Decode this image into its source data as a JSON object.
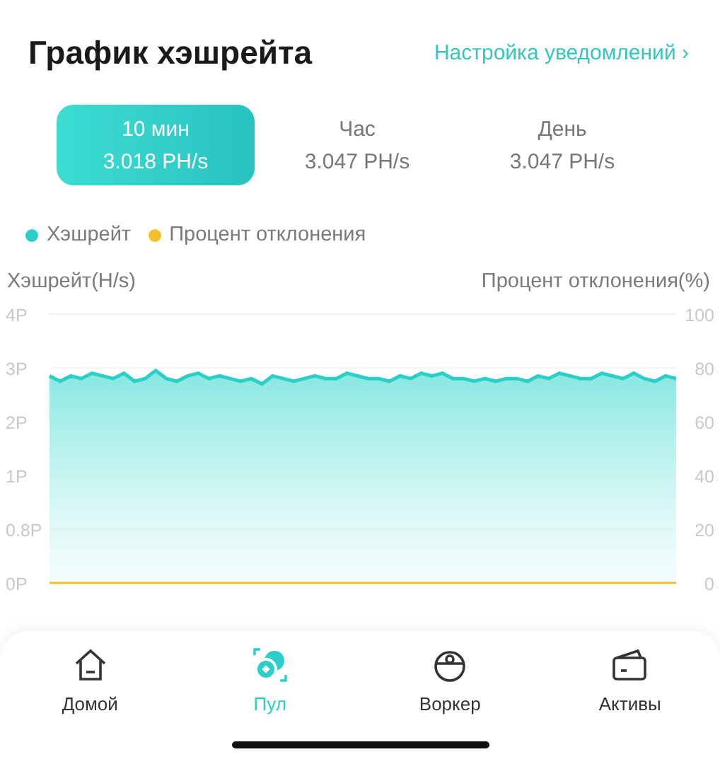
{
  "header": {
    "title": "График хэшрейта",
    "link": "Настройка уведомлений",
    "link_chevron": "›"
  },
  "periods": [
    {
      "label": "10 мин",
      "value": "3.018 PH/s",
      "selected": true
    },
    {
      "label": "Час",
      "value": "3.047 PH/s",
      "selected": false
    },
    {
      "label": "День",
      "value": "3.047 PH/s",
      "selected": false
    }
  ],
  "left_axis_labels": [
    "4P",
    "3P",
    "2P",
    "1P",
    "0.8P",
    "0P"
  ],
  "axis_titles": {
    "left": "Хэшрейт(H/s)",
    "right": "Процент отклонения(%)"
  },
  "chart_data": {
    "type": "line",
    "ylim": [
      0,
      100
    ],
    "yticks": [
      0,
      20,
      40,
      60,
      80,
      100
    ],
    "series": [
      {
        "name": "Хэшрейт",
        "color": "#2ccfc8",
        "values": [
          77,
          75,
          77,
          76,
          78,
          77,
          76,
          78,
          75,
          76,
          79,
          76,
          75,
          77,
          78,
          76,
          77,
          76,
          75,
          76,
          74,
          77,
          76,
          75,
          76,
          77,
          76,
          76,
          78,
          77,
          76,
          76,
          75,
          77,
          76,
          78,
          77,
          78,
          76,
          76,
          75,
          76,
          75,
          76,
          76,
          75,
          77,
          76,
          78,
          77,
          76,
          76,
          78,
          77,
          76,
          78,
          76,
          75,
          77,
          76
        ]
      },
      {
        "name": "Процент отклонения",
        "color": "#f5bf2a",
        "values": [
          0,
          0,
          0,
          0,
          0,
          0,
          0,
          0,
          0,
          0,
          0,
          0,
          0,
          0,
          0,
          0,
          0,
          0,
          0,
          0,
          0,
          0,
          0,
          0,
          0,
          0,
          0,
          0,
          0,
          0,
          0,
          0,
          0,
          0,
          0,
          0,
          0,
          0,
          0,
          0,
          0,
          0,
          0,
          0,
          0,
          0,
          0,
          0,
          0,
          0,
          0,
          0,
          0,
          0,
          0,
          0,
          0,
          0,
          0,
          0
        ]
      }
    ]
  },
  "nav": [
    {
      "label": "Домой",
      "kind": "home",
      "selected": false
    },
    {
      "label": "Пул",
      "kind": "pool",
      "selected": true
    },
    {
      "label": "Воркер",
      "kind": "worker",
      "selected": false
    },
    {
      "label": "Активы",
      "kind": "wallet",
      "selected": false
    }
  ]
}
